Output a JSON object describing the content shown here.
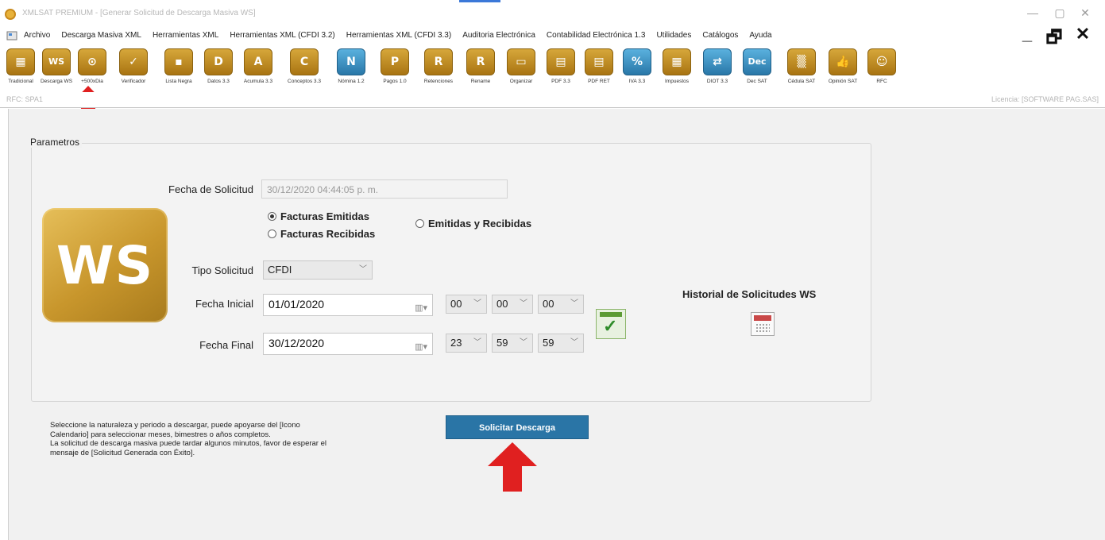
{
  "window": {
    "title": "XMLSAT PREMIUM   - [Generar Solicitud de Descarga Masiva WS]",
    "controls": [
      "—",
      "▢",
      "✕"
    ]
  },
  "menu": {
    "items": [
      "Archivo",
      "Descarga Masiva XML",
      "Herramientas XML",
      "Herramientas XML (CFDI 3.2)",
      "Herramientas XML (CFDI 3.3)",
      "Auditoria Electrónica",
      "Contabilidad Electrónica 1.3",
      "Utilidades",
      "Catálogos",
      "Ayuda"
    ],
    "mdi_controls": [
      "_",
      "🗗",
      "✕"
    ]
  },
  "toolbar": {
    "tools": [
      {
        "label": "Tradicional",
        "glyph": "▦"
      },
      {
        "label": "Descarga WS",
        "glyph": "WS"
      },
      {
        "label": "+500xDia",
        "glyph": "⊙"
      },
      {
        "label": "Verificador",
        "glyph": "✓"
      },
      {
        "label": "Lista Negra",
        "glyph": "▪"
      },
      {
        "label": "Datos 3.3",
        "glyph": "D"
      },
      {
        "label": "Acumula 3.3",
        "glyph": "A"
      },
      {
        "label": "Conceptos 3.3",
        "glyph": "C"
      },
      {
        "label": "Nómina 1.2",
        "glyph": "N"
      },
      {
        "label": "Pagos 1.0",
        "glyph": "P"
      },
      {
        "label": "Retenciones",
        "glyph": "R"
      },
      {
        "label": "Rename",
        "glyph": "R"
      },
      {
        "label": "Organizar",
        "glyph": "▭"
      },
      {
        "label": "PDF 3.3",
        "glyph": "▤"
      },
      {
        "label": "PDF RET",
        "glyph": "▤"
      },
      {
        "label": "IVA 3.3",
        "glyph": "%"
      },
      {
        "label": "Impuestos",
        "glyph": "▦"
      },
      {
        "label": "DIOT 3.3",
        "glyph": "⇄"
      },
      {
        "label": "Dec SAT",
        "glyph": "Dec"
      },
      {
        "label": "Cédula SAT",
        "glyph": "▒"
      },
      {
        "label": "Opinión SAT",
        "glyph": "👍"
      },
      {
        "label": "RFC",
        "glyph": "☺"
      }
    ]
  },
  "status": {
    "rfc": "RFC: SPA1",
    "licencia": "Licencia: [SOFTWARE PAG.SAS]"
  },
  "form": {
    "group_title": "Parametros",
    "logo_text": "WS",
    "fecha_solicitud_label": "Fecha de Solicitud",
    "fecha_solicitud_value": "30/12/2020 04:44:05 p. m.",
    "radio_emitidas": "Facturas Emitidas",
    "radio_recibidas": "Facturas Recibidas",
    "radio_ambas": "Emitidas y Recibidas",
    "selected_radio": "Facturas Emitidas",
    "tipo_label": "Tipo Solicitud",
    "tipo_value": "CFDI",
    "fecha_inicial_label": "Fecha Inicial",
    "fecha_inicial_value": "01/01/2020",
    "inicial_hh": "00",
    "inicial_mm": "00",
    "inicial_ss": "00",
    "fecha_final_label": "Fecha Final",
    "fecha_final_value": "30/12/2020",
    "final_hh": "23",
    "final_mm": "59",
    "final_ss": "59",
    "historial_title": "Historial de Solicitudes WS"
  },
  "instructions": {
    "line1": "Seleccione la naturaleza y periodo a descargar, puede apoyarse del [Icono Calendario] para seleccionar meses, bimestres o años completos.",
    "line2": "La solicitud de descarga masiva puede tardar algunos minutos, favor de esperar el mensaje de [Solicitud Generada con Éxito]."
  },
  "buttons": {
    "solicitar": "Solicitar  Descarga"
  },
  "colors": {
    "accent_gold": "#c8962c",
    "button_blue": "#2a75a6",
    "arrow_red": "#e02020"
  }
}
